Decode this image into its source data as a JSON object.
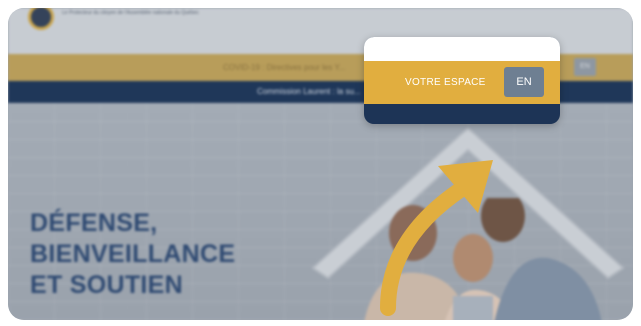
{
  "site": {
    "org_name": "Le Protecteur du citoyen de l'Assemblée nationale du Québec",
    "alert": "COVID-19 : Directives pour les Y...",
    "nav_text": "Commission Laurent : la su...",
    "language_button": "EN"
  },
  "hero": {
    "heading_line1": "DÉFENSE,",
    "heading_line2": "BIENVEILLANCE",
    "heading_line3": "ET SOUTIEN"
  },
  "popup": {
    "account_label": "VOTRE ESPACE",
    "language_button": "EN"
  },
  "colors": {
    "gold": "#e1ae3f",
    "navy": "#1d3456",
    "language_button_gray": "#6e7f92",
    "heading_blue": "#2f4a72"
  }
}
